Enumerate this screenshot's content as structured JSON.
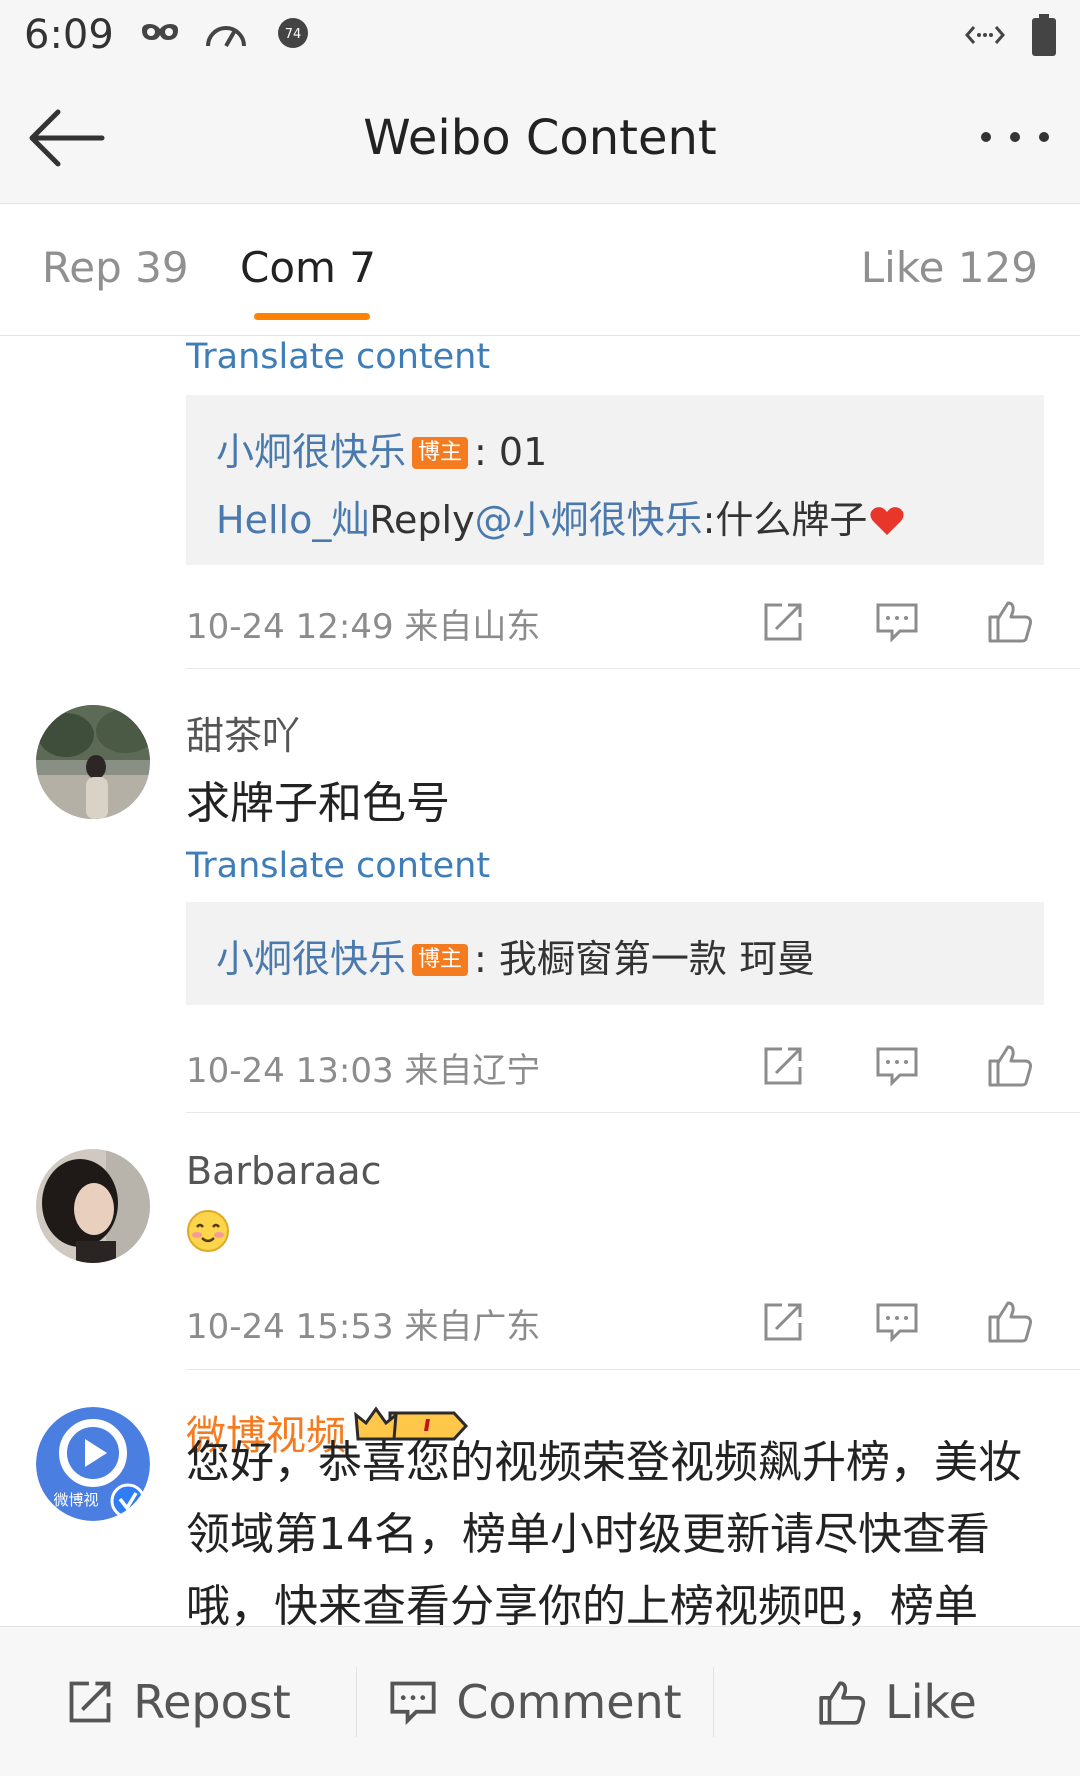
{
  "status_bar": {
    "time": "6:09",
    "badge_number": "74"
  },
  "header": {
    "title": "Weibo Content"
  },
  "tabs": [
    {
      "label": "Rep 39"
    },
    {
      "label": "Com 7"
    },
    {
      "label": "Like 129"
    }
  ],
  "comments": [
    {
      "translate_label": "Translate content",
      "quote": {
        "author": "小炯很快乐",
        "badge": "博主",
        "line1_rest": ": 01",
        "line2_user": "Hello_灿",
        "line2_reply": "Reply",
        "line2_mention": "@小炯很快乐",
        "line2_text": ":什么牌子"
      },
      "meta": "10-24 12:49  来自山东"
    },
    {
      "username": "甜茶吖",
      "text": "求牌子和色号",
      "translate_label": "Translate content",
      "quote": {
        "author": "小炯很快乐",
        "badge": "博主",
        "text": ": 我橱窗第一款 珂曼"
      },
      "meta": "10-24 13:03  来自辽宁"
    },
    {
      "username": "Barbaraac",
      "meta": "10-24 15:53  来自广东"
    },
    {
      "username": "微博视频",
      "avatar_label": "微博视",
      "text": "您好，恭喜您的视频荣登视频飙升榜，美妆领域第14名，榜单小时级更新请尽快查看哦，快来查看分享你的上榜视频吧，榜单"
    }
  ],
  "bottom_bar": {
    "repost_label": "Repost",
    "comment_label": "Comment",
    "like_label": "Like"
  },
  "colors": {
    "accent": "#ff8200",
    "link": "#4a7aad",
    "badge": "#f47b20"
  }
}
